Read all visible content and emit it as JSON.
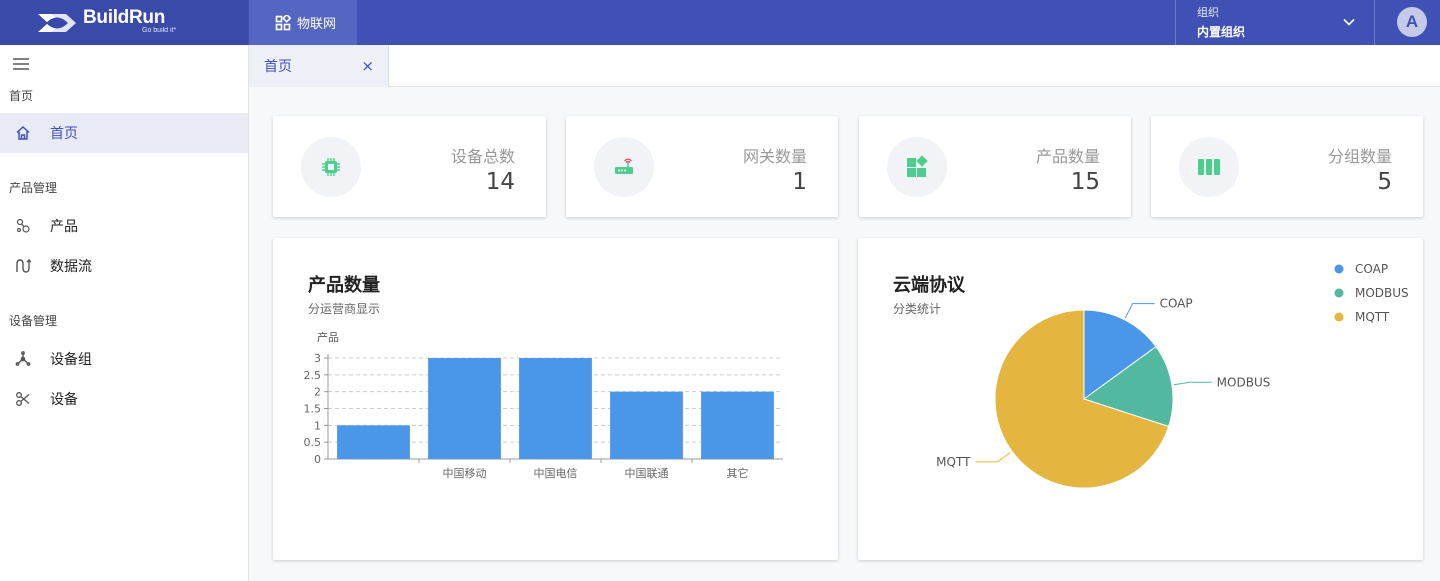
{
  "brand": {
    "name": "BuildRun",
    "tagline": "Go build it*"
  },
  "topnav": {
    "active_label": "物联网"
  },
  "org": {
    "label": "组织",
    "value": "内置组织"
  },
  "user": {
    "avatar_letter": "A"
  },
  "sidebar": {
    "groups": [
      {
        "title": "首页",
        "items": [
          {
            "label": "首页",
            "icon": "home-icon",
            "active": true
          }
        ]
      },
      {
        "title": "产品管理",
        "items": [
          {
            "label": "产品",
            "icon": "product-icon"
          },
          {
            "label": "数据流",
            "icon": "dataflow-icon"
          }
        ]
      },
      {
        "title": "设备管理",
        "items": [
          {
            "label": "设备组",
            "icon": "device-group-icon"
          },
          {
            "label": "设备",
            "icon": "device-icon"
          }
        ]
      }
    ]
  },
  "tabs": [
    {
      "label": "首页",
      "close": "×"
    }
  ],
  "stats": [
    {
      "label": "设备总数",
      "value": "14",
      "icon": "chip-icon"
    },
    {
      "label": "网关数量",
      "value": "1",
      "icon": "router-icon"
    },
    {
      "label": "产品数量",
      "value": "15",
      "icon": "widgets-icon"
    },
    {
      "label": "分组数量",
      "value": "5",
      "icon": "columns-icon"
    }
  ],
  "colors": {
    "primary": "#3f51b5",
    "accent_green": "#4ccf8e",
    "bar": "#4a96e8",
    "pie": [
      "#4a96e8",
      "#52b9a0",
      "#e4b53f"
    ]
  },
  "bar_chart": {
    "title": "产品数量",
    "subtitle": "分运营商显示"
  },
  "pie_chart": {
    "title": "云端协议",
    "subtitle": "分类统计"
  },
  "chart_data": [
    {
      "type": "bar",
      "title": "产品数量",
      "subtitle": "分运营商显示",
      "ylabel": "产品",
      "categories": [
        "",
        "中国移动",
        "中国电信",
        "中国联通",
        "其它"
      ],
      "values": [
        1,
        3,
        3,
        2,
        2
      ],
      "yticks": [
        "0",
        "0.5",
        "1",
        "1.5",
        "2",
        "2.5",
        "3"
      ],
      "ylim": [
        0,
        3
      ],
      "grid": true
    },
    {
      "type": "pie",
      "title": "云端协议",
      "subtitle": "分类统计",
      "labels": [
        "COAP",
        "MODBUS",
        "MQTT"
      ],
      "values": [
        15,
        15,
        70
      ],
      "legend": "top-right"
    }
  ]
}
